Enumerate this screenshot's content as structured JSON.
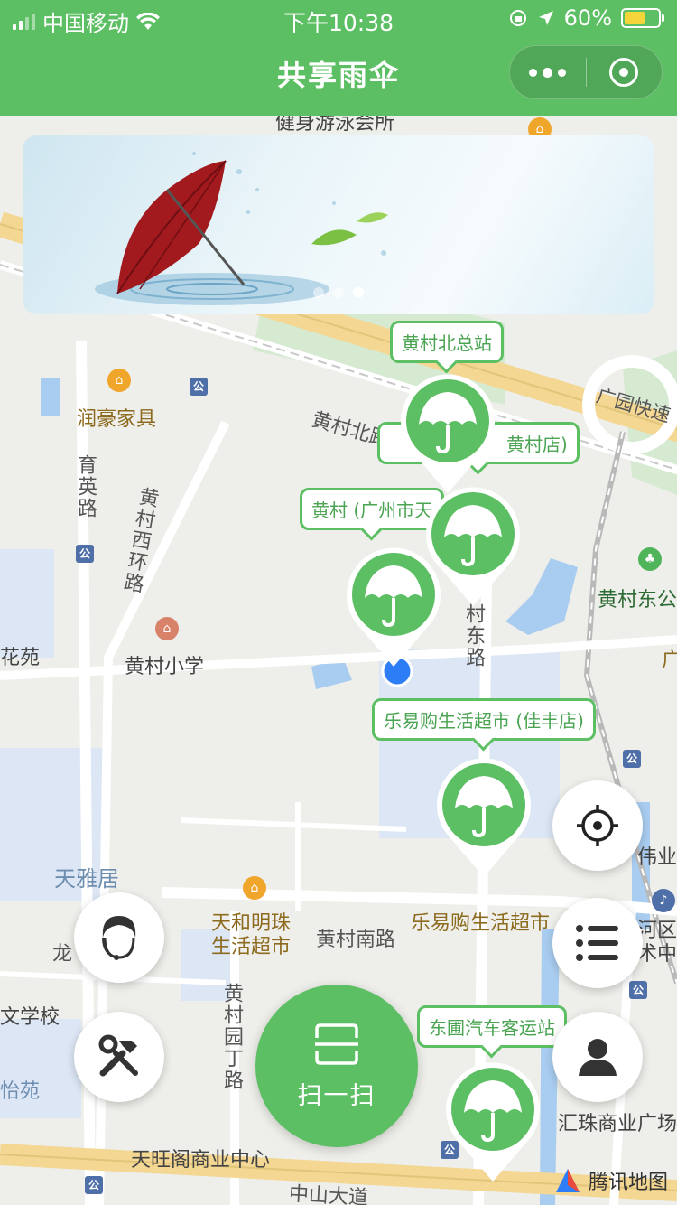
{
  "status_bar": {
    "carrier": "中国移动",
    "time": "下午10:38",
    "battery_percent": "60%",
    "battery_level": 0.6
  },
  "nav": {
    "title": "共享雨伞"
  },
  "banner": {
    "slides": 3,
    "active_slide": 3
  },
  "map": {
    "labels": {
      "jianshen": "健身游泳会所",
      "runhao": "润豪家具",
      "huangcun_bei": "黄村北路",
      "guangyuan": "广园快速",
      "yuying": "育英路",
      "huangcun_xihuan": "黄村西环路",
      "huangcun_dong_park": "黄村东公",
      "huayuan": "花苑",
      "xiaoxue": "黄村小学",
      "huangcun_donglu": "村东路",
      "guang": "广",
      "weiye": "伟业",
      "tianyaju": "天雅居",
      "tianhe_mingzhu": "天和明珠\n生活超市",
      "huangcun_nan": "黄村南路",
      "leyigou_map": "乐易购生活超市",
      "hequ": "河区\n术中",
      "long": "龙",
      "wenxuexiao": "文学校",
      "huangcun_yuanding": "黄村园丁路",
      "yiyuan": "怡苑",
      "tianwang": "天旺阁商业中心",
      "huizhu": "汇珠商业广场",
      "zhongshan": "中山大道"
    },
    "map_logo": "腾讯地图"
  },
  "stations": [
    {
      "name": "黄村北总站"
    },
    {
      "name": "黄村店)"
    },
    {
      "name": "黄村 (广州市天"
    },
    {
      "name": "乐易购生活超市 (佳丰店)"
    },
    {
      "name": "东圃汽车客运站"
    }
  ],
  "actions": {
    "scan_label": "扫一扫"
  },
  "colors": {
    "brand_green": "#5cbf63",
    "battery_yellow": "#f5d53a"
  },
  "icons": {
    "locate": "crosshair-icon",
    "list": "list-icon",
    "service": "customer-service-icon",
    "tools": "tools-icon",
    "user": "user-icon",
    "scan": "scan-icon",
    "umbrella": "umbrella-icon"
  }
}
